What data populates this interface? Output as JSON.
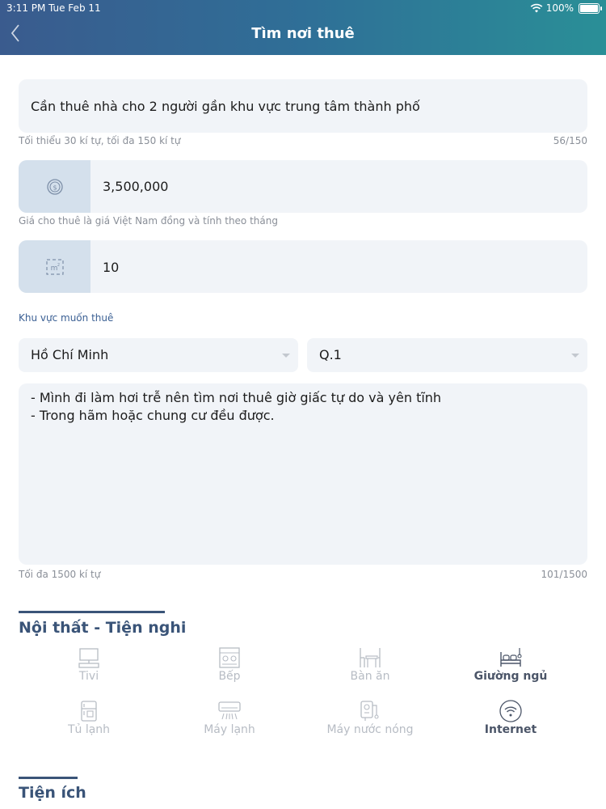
{
  "status_bar": {
    "time": "3:11 PM",
    "date": "Tue Feb 11",
    "battery": "100%"
  },
  "header": {
    "title": "Tìm nơi thuê"
  },
  "title_field": {
    "value": "Cần thuê nhà cho 2 người gần khu vực trung tâm thành phố",
    "hint": "Tối thiểu 30 kí tự, tối đa 150 kí tự",
    "counter": "56/150"
  },
  "price_field": {
    "icon": "coin-icon",
    "value": "3,500,000",
    "hint": "Giá cho thuê là giá Việt Nam đồng và tính theo tháng"
  },
  "area_field": {
    "icon": "area-m2-icon",
    "value": "10"
  },
  "location": {
    "label": "Khu vực muốn thuê",
    "city": "Hồ Chí Minh",
    "district": "Q.1"
  },
  "description": {
    "lines": [
      "- Mình đi làm hơi trễ nên tìm nơi thuê giờ giấc tự do và yên tĩnh",
      "- Trong hãm hoặc chung cư đều được."
    ],
    "hint": "Tối đa 1500 kí tự",
    "counter": "101/1500"
  },
  "furniture": {
    "title": "Nội thất - Tiện nghi",
    "items": [
      {
        "label": "Tivi",
        "icon": "tv-icon",
        "selected": false
      },
      {
        "label": "Bếp",
        "icon": "stove-icon",
        "selected": false
      },
      {
        "label": "Bàn ăn",
        "icon": "dining-table-icon",
        "selected": false
      },
      {
        "label": "Giường ngủ",
        "icon": "bed-icon",
        "selected": true
      },
      {
        "label": "Tủ lạnh",
        "icon": "fridge-icon",
        "selected": false
      },
      {
        "label": "Máy lạnh",
        "icon": "air-conditioner-icon",
        "selected": false
      },
      {
        "label": "Máy nước nóng",
        "icon": "water-heater-icon",
        "selected": false
      },
      {
        "label": "Internet",
        "icon": "wifi-icon",
        "selected": true
      }
    ]
  },
  "utilities": {
    "title": "Tiện ích"
  },
  "colors": {
    "accent": "#3a5478",
    "header_start": "#3a5b8e",
    "header_end": "#2a8f97",
    "field_bg": "#f1f4f8",
    "icon_cell": "#d4e0ec"
  }
}
